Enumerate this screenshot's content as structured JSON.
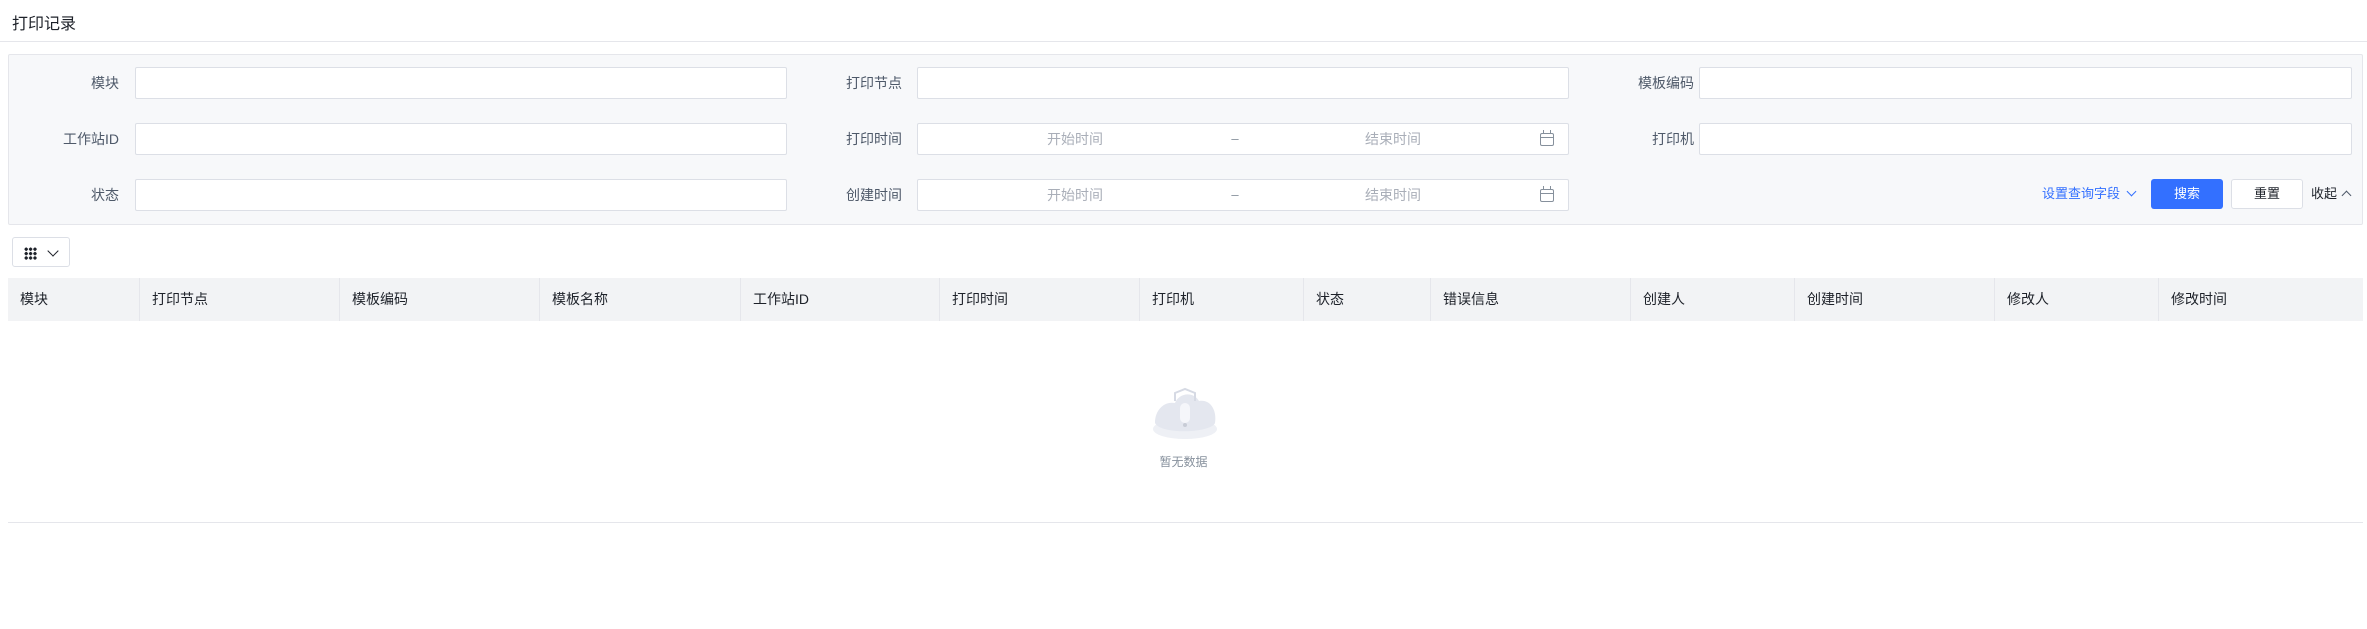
{
  "page": {
    "title": "打印记录"
  },
  "filters": {
    "module": {
      "label": "模块",
      "value": ""
    },
    "print_node": {
      "label": "打印节点",
      "value": ""
    },
    "template_code": {
      "label": "模板编码",
      "value": ""
    },
    "workstation_id": {
      "label": "工作站ID",
      "value": ""
    },
    "print_time": {
      "label": "打印时间",
      "start_placeholder": "开始时间",
      "separator": "–",
      "end_placeholder": "结束时间"
    },
    "printer": {
      "label": "打印机",
      "value": ""
    },
    "status": {
      "label": "状态",
      "value": ""
    },
    "create_time": {
      "label": "创建时间",
      "start_placeholder": "开始时间",
      "separator": "–",
      "end_placeholder": "结束时间"
    }
  },
  "actions": {
    "set_query_fields": "设置查询字段",
    "search": "搜索",
    "reset": "重置",
    "collapse": "收起"
  },
  "table": {
    "columns": [
      "模块",
      "打印节点",
      "模板编码",
      "模板名称",
      "工作站ID",
      "打印时间",
      "打印机",
      "状态",
      "错误信息",
      "创建人",
      "创建时间",
      "修改人",
      "修改时间"
    ],
    "rows": [],
    "empty_text": "暂无数据"
  },
  "colors": {
    "primary": "#3370ff",
    "panel_bg": "#f7f8fa",
    "header_bg": "#f2f3f5"
  }
}
